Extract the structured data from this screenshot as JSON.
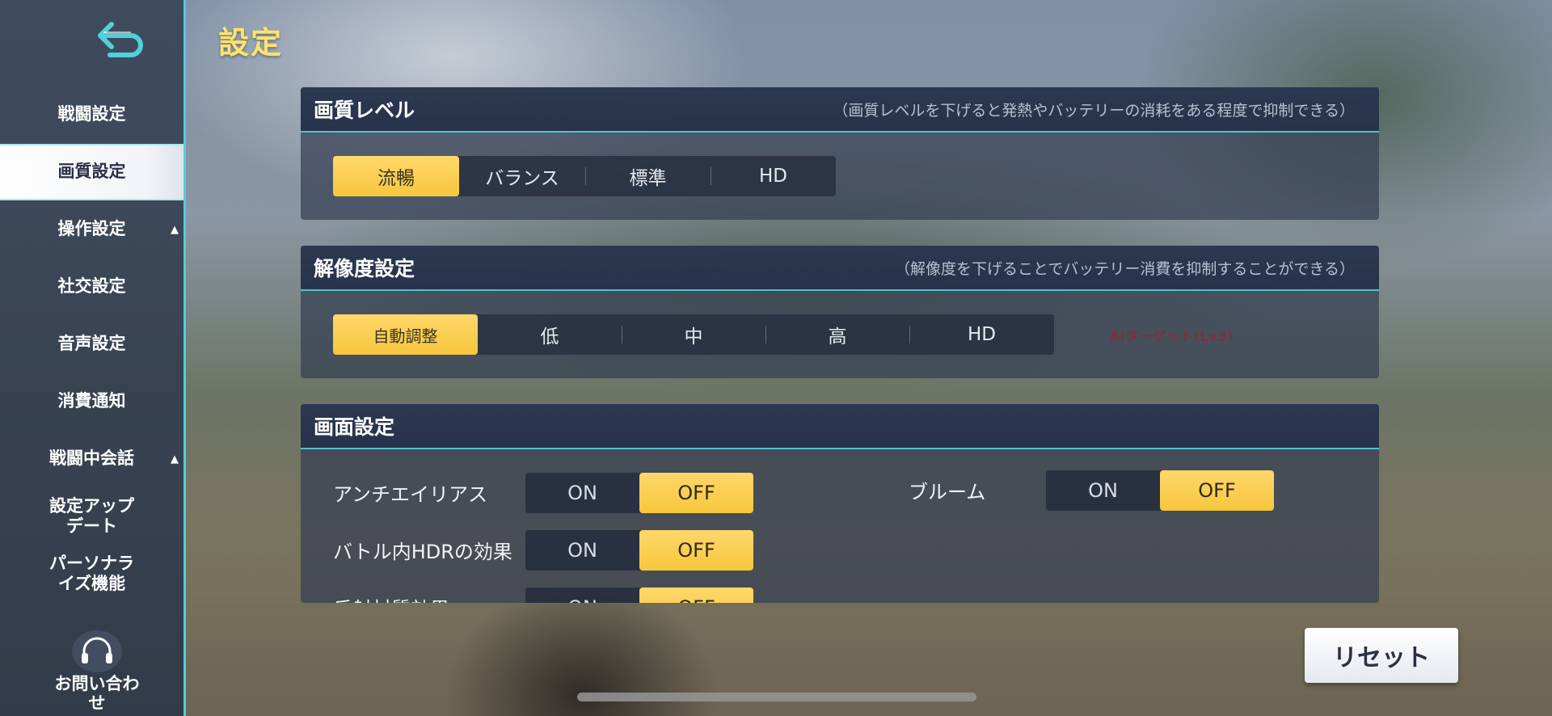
{
  "page": {
    "title": "設定"
  },
  "sidebar": {
    "items": [
      {
        "label": "戦闘設定",
        "caret": ""
      },
      {
        "label": "画質設定",
        "caret": "",
        "active": true
      },
      {
        "label": "操作設定",
        "caret": "▲"
      },
      {
        "label": "社交設定",
        "caret": ""
      },
      {
        "label": "音声設定",
        "caret": ""
      },
      {
        "label": "消費通知",
        "caret": ""
      },
      {
        "label": "戦闘中会話",
        "caret": "▲"
      },
      {
        "label_line1": "設定アップ",
        "label_line2": "デート"
      },
      {
        "label_line1": "パーソナラ",
        "label_line2": "イズ機能"
      }
    ],
    "support_line1": "お問い合わ",
    "support_line2": "せ"
  },
  "quality": {
    "title": "画質レベル",
    "hint": "（画質レベルを下げると発熱やバッテリーの消耗をある程度で抑制できる）",
    "options": [
      "流暢",
      "バランス",
      "標準",
      "HD"
    ],
    "selected": "流暢"
  },
  "resolution": {
    "title": "解像度設定",
    "hint": "（解像度を下げることでバッテリー消費を抑制することができる）",
    "options": [
      "自動調整",
      "低",
      "中",
      "高",
      "HD"
    ],
    "selected": "自動調整",
    "ai_target": "AIターゲット(Lv3)"
  },
  "screen": {
    "title": "画面設定",
    "on_label": "ON",
    "off_label": "OFF",
    "rows": [
      {
        "label": "アンチエイリアス",
        "value": "OFF"
      },
      {
        "label": "バトル内HDRの効果",
        "value": "OFF"
      },
      {
        "label": "反射材質効果",
        "value": "OFF"
      },
      {
        "label": "ブルーム",
        "value": "OFF"
      }
    ]
  },
  "footer": {
    "reset_label": "リセット"
  },
  "colors": {
    "accent": "#f7c63d",
    "teal": "#4fd0da",
    "title_yellow": "#ffe36b"
  }
}
